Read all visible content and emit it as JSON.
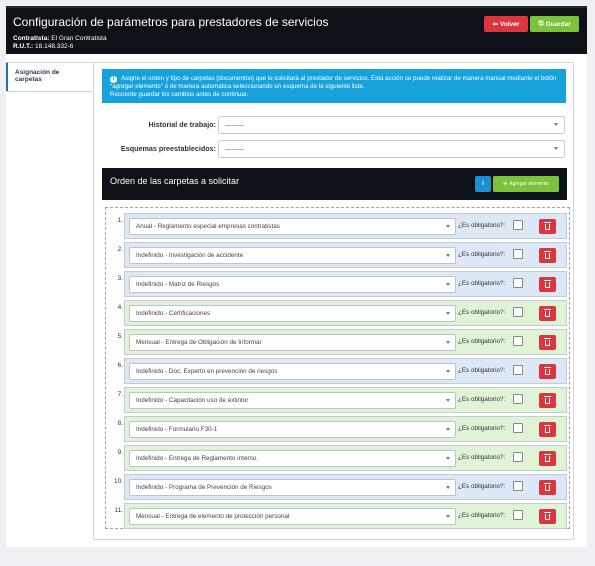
{
  "header": {
    "title": "Configuración de parámetros para prestadores de servicios",
    "contratista_label": "Contratista:",
    "contratista_value": "El Gran Contratista",
    "rut_label": "R.U.T.:",
    "rut_value": "18.148.332-6",
    "back_label": "Volver",
    "save_label": "Guardar"
  },
  "sidebar": {
    "tab_label": "Asignación de carpetas"
  },
  "info": {
    "text": "Asigne el orden y tipo de carpetas (documentos) que le solicitará al prestador de servicios. Esta acción se puede realizar de manera manual mediante el botón \"agregar elemento\" ó de manera automática seleccionando un esquema de la siguiente lista.",
    "reminder": "Recuerde guardar los cambios antes de continuar."
  },
  "form": {
    "historial_label": "Historial de trabajo:",
    "historial_value": "---------",
    "esquemas_label": "Esquemas preestablecidos:",
    "esquemas_value": "---------"
  },
  "orden": {
    "title": "Orden de las carpetas a solicitar",
    "add_label": "Agregar elemento"
  },
  "obligatorio_label": "¿Es obligatorio?:",
  "colors": {
    "header_bg": "#0e1118",
    "info_bg": "#17a2dc",
    "danger": "#d9363e",
    "success": "#7cc23a",
    "row_blue": "#dde8f6",
    "row_green": "#dff3d6"
  },
  "items": [
    {
      "num": "1.",
      "value": "Anual - Reglamento especial empresas contratistas",
      "color": "blue"
    },
    {
      "num": "2.",
      "value": "Indefinido - Investigación de accidente",
      "color": "blue"
    },
    {
      "num": "3.",
      "value": "Indefinido - Matriz de Riesgos",
      "color": "blue"
    },
    {
      "num": "4.",
      "value": "Indefinido - Certificaciones",
      "color": "green"
    },
    {
      "num": "5.",
      "value": "Mensual - Entrega de Obligación de Informar",
      "color": "green"
    },
    {
      "num": "6.",
      "value": "Indefinido - Doc. Experto en prevención de riesgos",
      "color": "blue"
    },
    {
      "num": "7.",
      "value": "Indefinido - Capacitación uso de extintor",
      "color": "green"
    },
    {
      "num": "8.",
      "value": "Indefinido - Formulario F30-1",
      "color": "green"
    },
    {
      "num": "9.",
      "value": "Indefinido - Entrega de Reglamento interno.",
      "color": "green"
    },
    {
      "num": "10.",
      "value": "Indefinido - Programa de Prevención de Riesgos",
      "color": "blue"
    },
    {
      "num": "11.",
      "value": "Mensual - Entrega de elemento de protección personal",
      "color": "green"
    }
  ]
}
